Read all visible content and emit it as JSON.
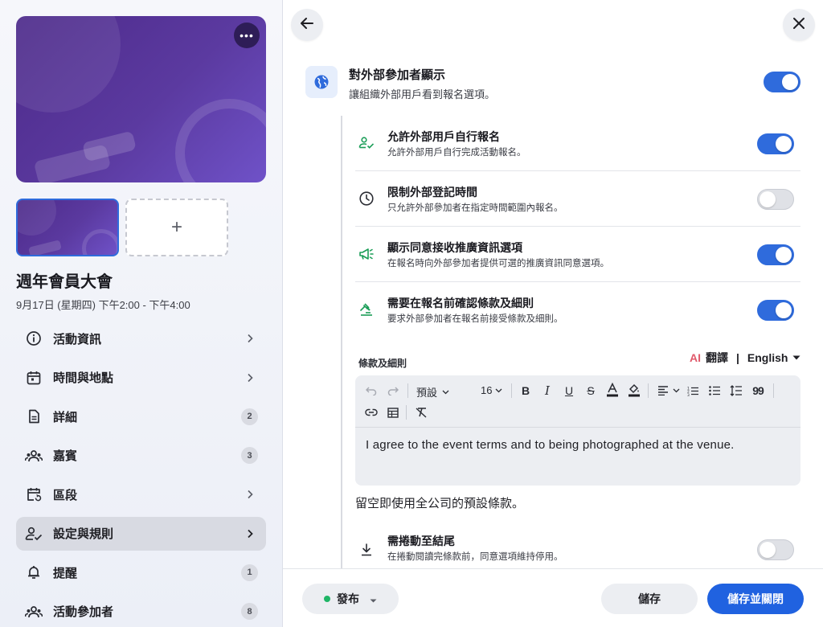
{
  "sidebar": {
    "more_icon": "more-horizontal-icon",
    "add_icon": "plus-icon",
    "event_title": "週年會員大會",
    "event_time": "9月17日 (星期四) 下午2:00 - 下午4:00",
    "items": [
      {
        "label": "活動資訊",
        "icon": "info-icon",
        "badge": null,
        "active": false
      },
      {
        "label": "時間與地點",
        "icon": "calendar-icon",
        "badge": null,
        "active": false
      },
      {
        "label": "詳細",
        "icon": "document-icon",
        "badge": "2",
        "active": false
      },
      {
        "label": "嘉賓",
        "icon": "people-icon",
        "badge": "3",
        "active": false
      },
      {
        "label": "區段",
        "icon": "calendar-repeat-icon",
        "badge": null,
        "active": false
      },
      {
        "label": "設定與規則",
        "icon": "user-check-icon",
        "badge": null,
        "active": true
      },
      {
        "label": "提醒",
        "icon": "bell-icon",
        "badge": "1",
        "active": false
      },
      {
        "label": "活動參加者",
        "icon": "people-icon",
        "badge": "8",
        "active": false
      }
    ]
  },
  "panel": {
    "back_icon": "arrow-left-icon",
    "close_icon": "close-icon",
    "main": {
      "icon": "globe-icon",
      "title": "對外部參加者顯示",
      "description": "讓組織外部用戶看到報名選項。",
      "enabled": true
    },
    "options": [
      {
        "icon": "user-check-icon",
        "title": "允許外部用戶自行報名",
        "description": "允許外部用戶自行完成活動報名。",
        "enabled": true
      },
      {
        "icon": "clock-icon",
        "title": "限制外部登記時間",
        "description": "只允許外部參加者在指定時間範圍內報名。",
        "enabled": false
      },
      {
        "icon": "megaphone-icon",
        "title": "顯示同意接收推廣資訊選項",
        "description": "在報名時向外部參加者提供可選的推廣資訊同意選項。",
        "enabled": true
      },
      {
        "icon": "gavel-icon",
        "title": "需要在報名前確認條款及細則",
        "description": "要求外部參加者在報名前接受條款及細則。",
        "enabled": true
      }
    ],
    "terms": {
      "label": "條款及細則",
      "ai_tag": "AI",
      "translate_label": "翻譯",
      "separator": "|",
      "language": "English",
      "editor": {
        "paragraph_style": "預設",
        "font_size": "16",
        "content": "I agree to the event terms and to being photographed at the venue."
      },
      "note": "留空即使用全公司的預設條款。"
    },
    "scroll_option": {
      "icon": "download-icon",
      "title": "需捲動至結尾",
      "description": "在捲動閱讀完條款前，同意選項維持停用。",
      "enabled": false
    },
    "footer": {
      "publish_label": "發布",
      "publish_status_color": "#1fb566",
      "save_label": "儲存",
      "save_close_label": "儲存並關閉"
    }
  },
  "colors": {
    "accent": "#2f6bdc",
    "primary_button": "#2062e0",
    "ai_tag": "#e05a6b",
    "option_icon": "#1a9d57"
  }
}
